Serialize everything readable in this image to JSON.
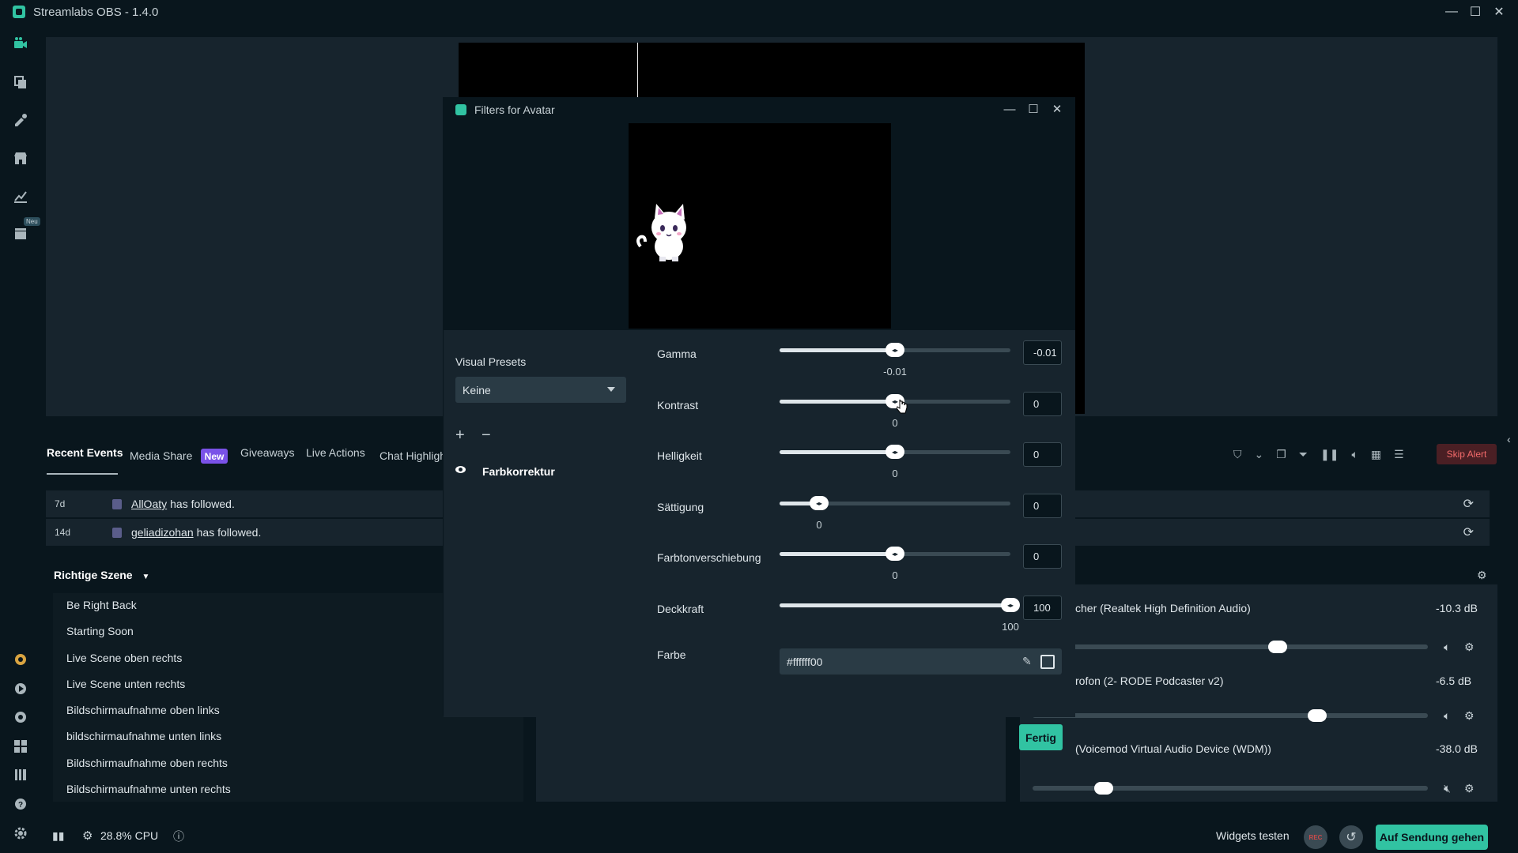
{
  "app": {
    "title": "Streamlabs OBS - 1.4.0"
  },
  "nav": {
    "neu_badge": "Neu"
  },
  "events": {
    "tabs": [
      "Recent Events",
      "Media Share",
      "Giveaways",
      "Live Actions",
      "Chat Highligh"
    ],
    "new_badge": "New",
    "rows": [
      {
        "time": "7d",
        "user": "AllOaty",
        "text": "has followed."
      },
      {
        "time": "14d",
        "user": "geliadizohan",
        "text": "has followed."
      }
    ],
    "skip_alert": "Skip Alert"
  },
  "scenes": {
    "collection": "Richtige Szene",
    "items": [
      "Be Right Back",
      "Starting Soon",
      "Live Scene oben rechts",
      "Live Scene unten rechts",
      "Bildschirmaufnahme oben links",
      "bildschirmaufnahme unten links",
      "Bildschirmaufnahme oben rechts",
      "Bildschirmaufnahme unten rechts"
    ]
  },
  "mixer": {
    "channels": [
      {
        "name": "cher (Realtek High Definition Audio)",
        "db": "-10.3 dB",
        "level": 0.62
      },
      {
        "name": "rofon (2- RODE Podcaster v2)",
        "db": "-6.5 dB",
        "level": 0.72
      },
      {
        "name": "(Voicemod Virtual Audio Device (WDM))",
        "db": "-38.0 dB",
        "level": 0.18
      }
    ]
  },
  "status": {
    "cpu": "28.8% CPU",
    "widgets_test": "Widgets testen",
    "rec": "REC",
    "go_live": "Auf Sendung gehen"
  },
  "dialog": {
    "title": "Filters for Avatar",
    "visual_presets_label": "Visual Presets",
    "visual_presets_value": "Keine",
    "filter_name": "Farbkorrektur",
    "params": [
      {
        "label": "Gamma",
        "value": "-0.01",
        "fraction": 0.5
      },
      {
        "label": "Kontrast",
        "value": "0",
        "fraction": 0.5
      },
      {
        "label": "Helligkeit",
        "value": "0",
        "fraction": 0.5
      },
      {
        "label": "Sättigung",
        "value": "0",
        "fraction": 0.17
      },
      {
        "label": "Farbtonverschiebung",
        "value": "0",
        "fraction": 0.5
      },
      {
        "label": "Deckkraft",
        "value": "100",
        "fraction": 1.0
      }
    ],
    "color_label": "Farbe",
    "color_value": "#ffffff00",
    "done": "Fertig"
  },
  "colors": {
    "accent": "#31c3a2",
    "twitch": "#7a52e8",
    "skip": "#f26a6a"
  },
  "icons": [
    "studio-icon",
    "themes-icon",
    "editor-icon",
    "store-icon",
    "analytics-icon",
    "highlighter-icon",
    "eye-icon",
    "eyedropper-icon",
    "gear-icon",
    "refresh-icon",
    "info-icon",
    "cpu-icon",
    "stats-icon"
  ]
}
